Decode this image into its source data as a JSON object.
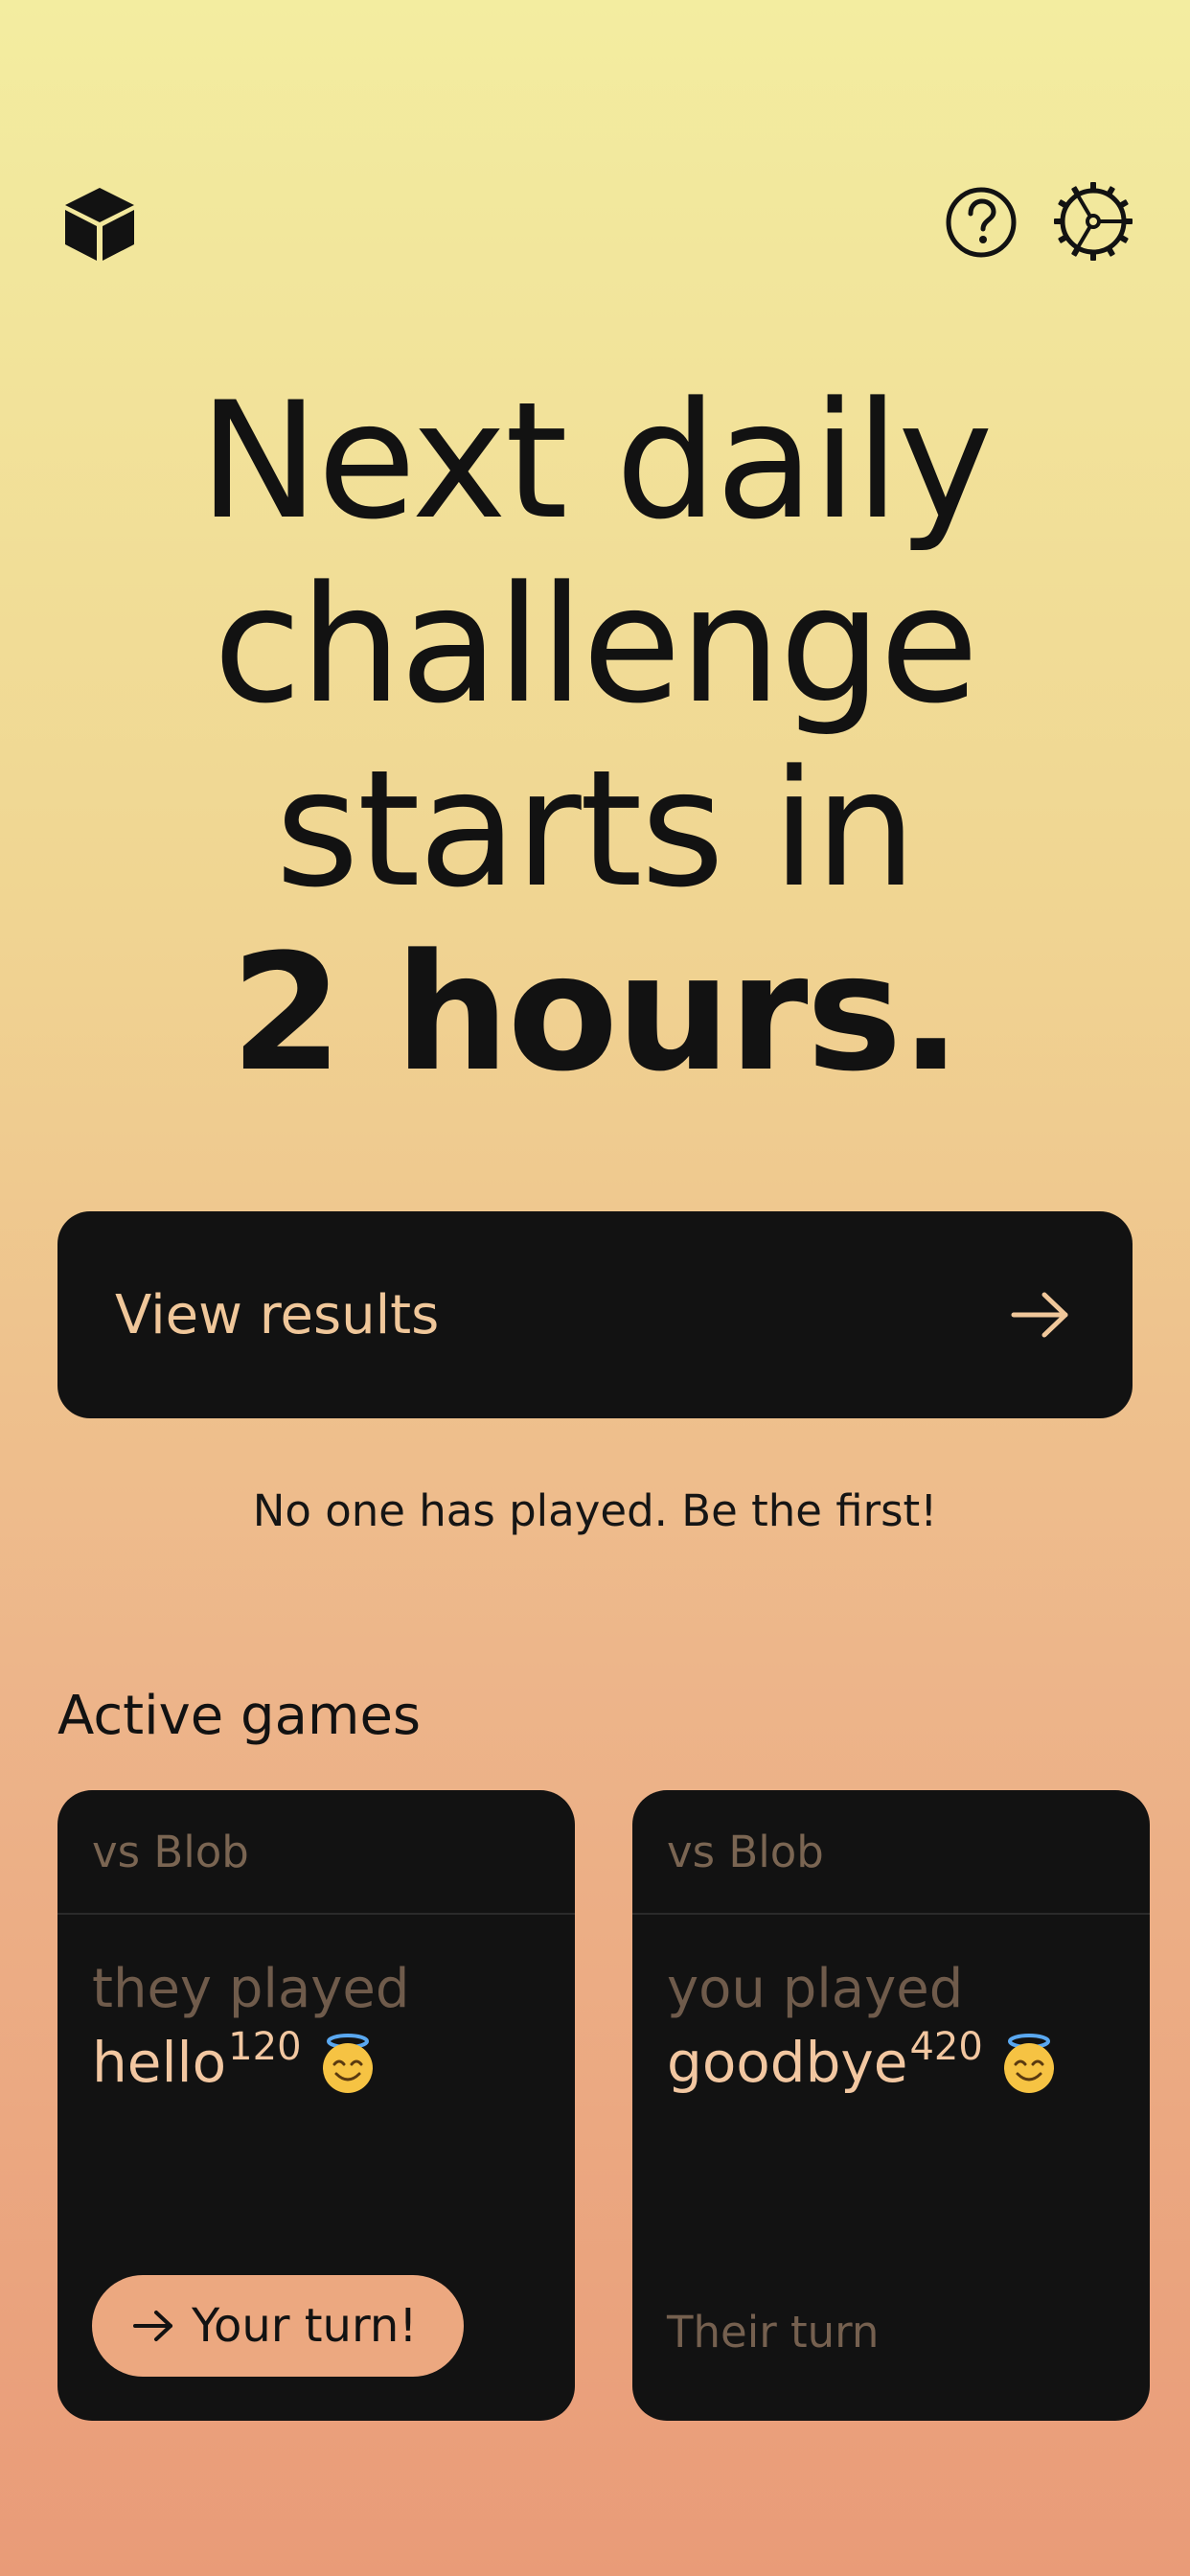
{
  "icons": {
    "logo": "cube-icon",
    "help": "question-circle-icon",
    "settings": "gear-icon"
  },
  "headline": {
    "line1": "Next daily",
    "line2": "challenge",
    "line3": "starts in",
    "line4": "2 hours."
  },
  "cta": {
    "label": "View results",
    "icon": "arrow-right-icon"
  },
  "notice": "No one has played. Be the first!",
  "active_games": {
    "title": "Active games",
    "games": [
      {
        "opponent": "vs Blob",
        "played_label": "they played",
        "word": "hello",
        "score": "120",
        "emoji": "smiling-face-with-halo",
        "turn_label": "Your turn!"
      },
      {
        "opponent": "vs Blob",
        "played_label": "you played",
        "word": "goodbye",
        "score": "420",
        "emoji": "smiling-face-with-halo",
        "turn_label": "Their turn"
      }
    ]
  },
  "colors": {
    "background_top": "#f3eda0",
    "background_bottom": "#e99b78",
    "card": "#121212",
    "accent_text": "#f0c79a",
    "turn_button": "#eca880"
  }
}
